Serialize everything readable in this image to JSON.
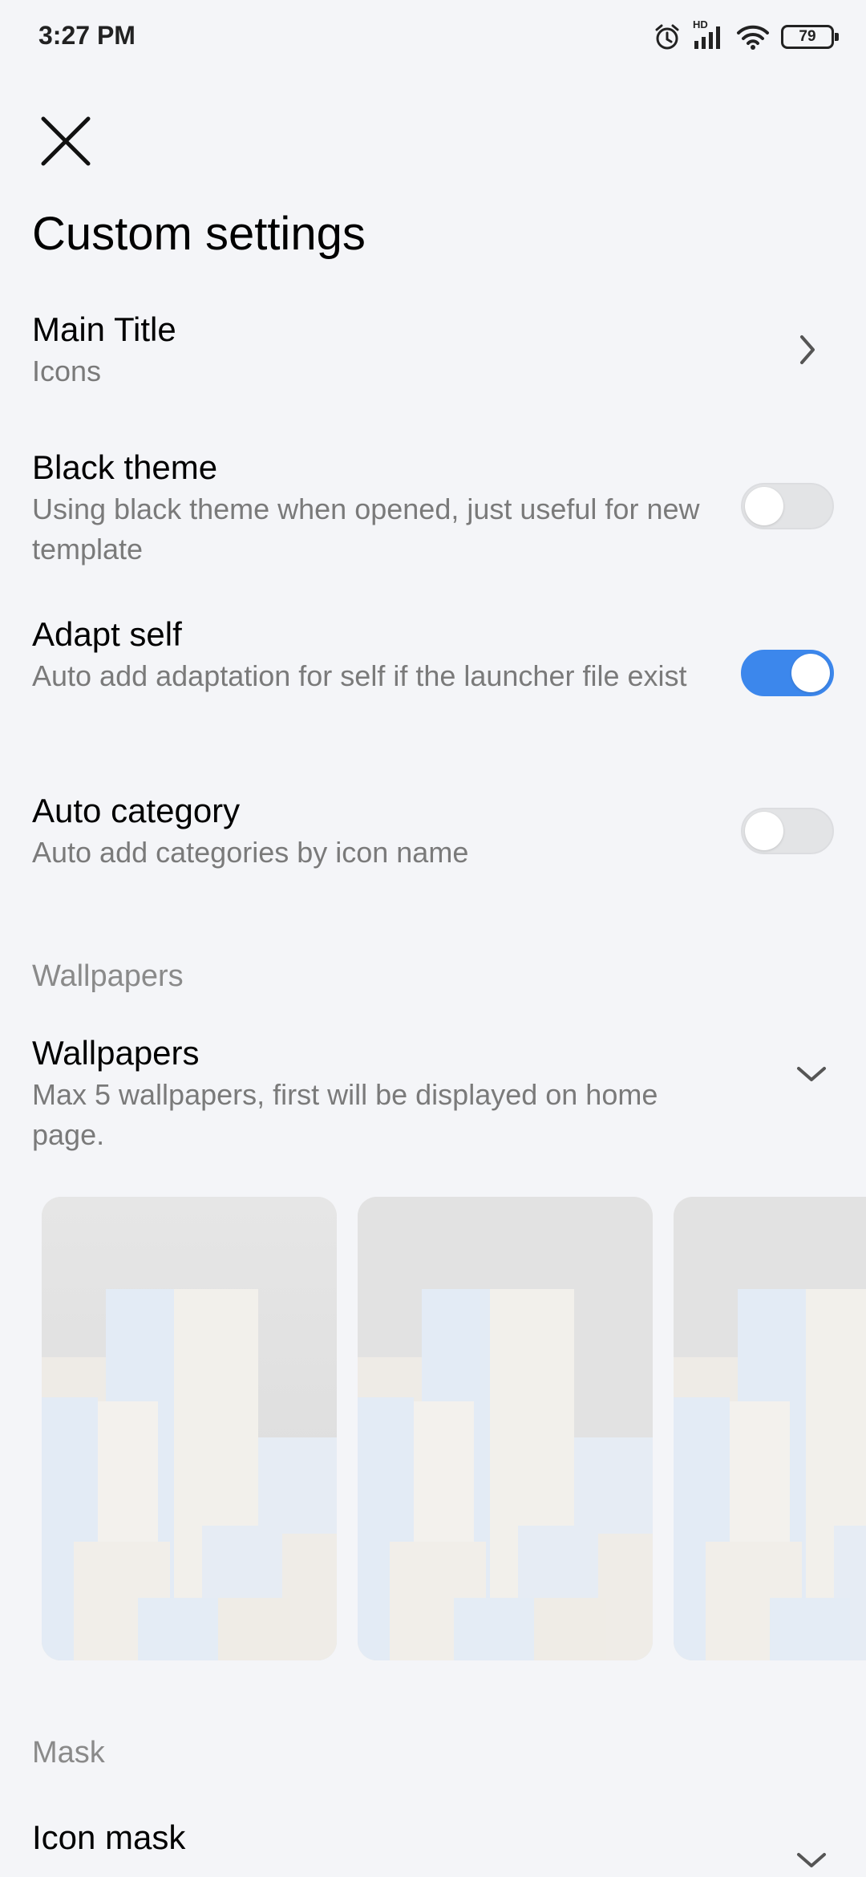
{
  "status_bar": {
    "time": "3:27 PM",
    "network_label": "HD",
    "battery": "79"
  },
  "page": {
    "title": "Custom settings"
  },
  "settings": {
    "main_title": {
      "label": "Main Title",
      "value": "Icons"
    },
    "black_theme": {
      "label": "Black theme",
      "description": "Using black theme when opened, just useful for new template",
      "enabled": false
    },
    "adapt_self": {
      "label": "Adapt self",
      "description": "Auto add adaptation for self if the launcher file exist",
      "enabled": true
    },
    "auto_category": {
      "label": "Auto category",
      "description": "Auto add categories by icon name",
      "enabled": false
    }
  },
  "sections": {
    "wallpapers": "Wallpapers",
    "mask": "Mask"
  },
  "wallpapers": {
    "label": "Wallpapers",
    "description": "Max 5 wallpapers, first will be displayed on home page.",
    "expanded": false
  },
  "icon_mask": {
    "label": "Icon mask",
    "expanded": false
  },
  "colors": {
    "accent": "#3c87ec",
    "background": "#f4f5f8",
    "secondary_text": "#7a7a7a"
  }
}
